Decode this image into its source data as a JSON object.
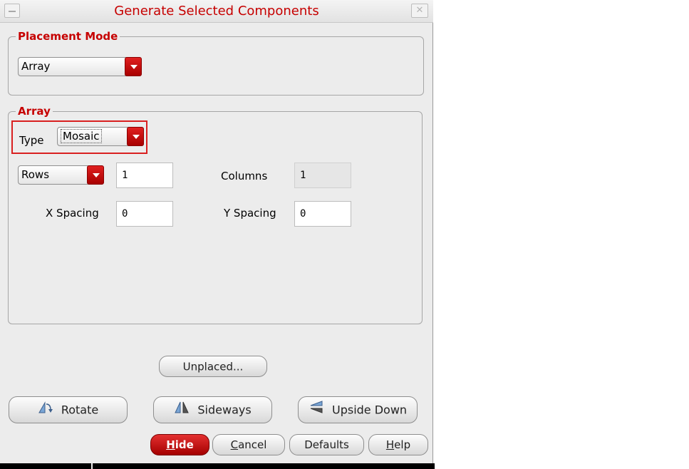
{
  "window": {
    "title": "Generate Selected Components"
  },
  "placement_mode": {
    "legend": "Placement Mode",
    "selected": "Array"
  },
  "array": {
    "legend": "Array",
    "type_label": "Type",
    "type_value": "Mosaic",
    "rows_selector": "Rows",
    "rows_value": "1",
    "columns_label": "Columns",
    "columns_value": "1",
    "x_spacing_label": "X Spacing",
    "x_spacing_value": "0",
    "y_spacing_label": "Y Spacing",
    "y_spacing_value": "0"
  },
  "buttons": {
    "unplaced": "Unplaced...",
    "rotate": "Rotate",
    "sideways": "Sideways",
    "upside_down": "Upside Down",
    "hide_mnemonic": "H",
    "hide_rest": "ide",
    "cancel_mnemonic": "C",
    "cancel_rest": "ancel",
    "defaults": "Defaults",
    "help_mnemonic": "H",
    "help_rest": "elp"
  },
  "icons": {
    "window_menu": "window-menu-icon",
    "close": "close-icon",
    "rotate": "rotate-icon",
    "sideways": "flip-horizontal-icon",
    "upside_down": "flip-vertical-icon",
    "dropdown": "chevron-down-icon"
  },
  "colors": {
    "accent": "#c60000",
    "highlight_box": "#d92020",
    "dialog_bg": "#ececec"
  }
}
